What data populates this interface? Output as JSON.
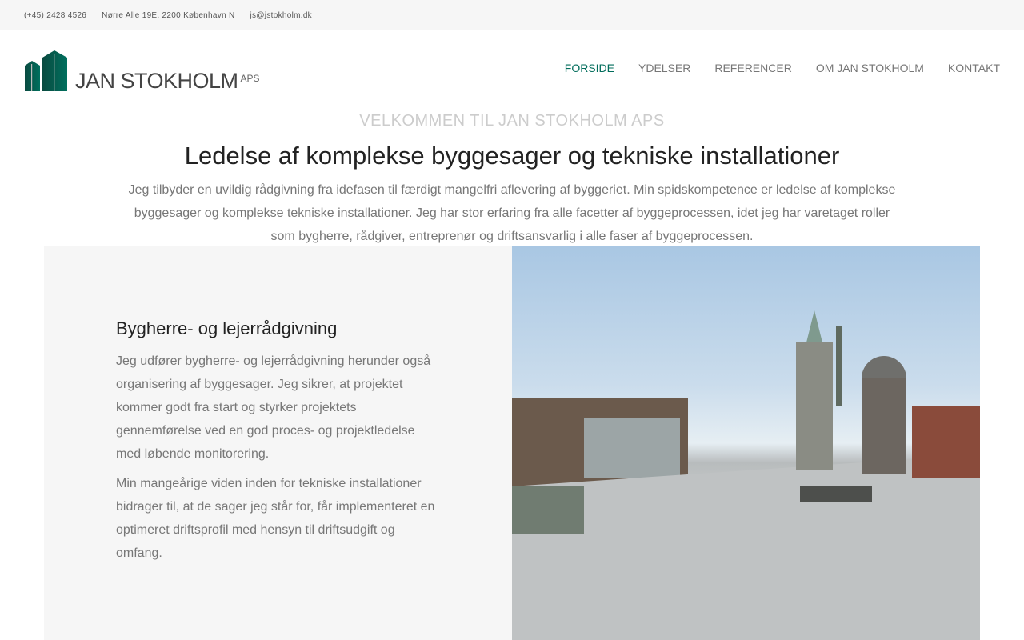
{
  "topbar": {
    "phone": "(+45) 2428 4526",
    "address": "Nørre Alle 19E, 2200 København N",
    "email": "js@jstokholm.dk"
  },
  "logo": {
    "name": "JAN STOKHOLM",
    "suffix": "APS"
  },
  "nav": [
    {
      "label": "FORSIDE"
    },
    {
      "label": "YDELSER"
    },
    {
      "label": "REFERENCER"
    },
    {
      "label": "OM JAN STOKHOLM"
    },
    {
      "label": "KONTAKT"
    }
  ],
  "intro": {
    "kicker": "VELKOMMEN TIL JAN STOKHOLM APS",
    "title": "Ledelse af komplekse byggesager og tekniske installationer",
    "text": "Jeg tilbyder en uvildig rådgivning fra idefasen til færdigt mangelfri aflevering af byggeriet. Min spidskompetence er ledelse af komplekse byggesager og komplekse tekniske installationer. Jeg har stor erfaring fra alle facetter af byggeprocessen, idet jeg har varetaget roller som bygherre, rådgiver, entreprenør og driftsansvarlig i alle faser af byggeprocessen."
  },
  "service": {
    "heading": "Bygherre- og lejerrådgivning",
    "p1": "Jeg udfører bygherre- og lejerrådgivning herunder også organisering af byggesager. Jeg sikrer, at projektet kommer godt fra start og styrker projektets gennemførelse ved en god proces- og projektledelse med løbende monitorering.",
    "p2": "Min mangeårige viden inden for tekniske installationer bidrager til, at de sager jeg står for, får implementeret en optimeret driftsprofil med hensyn til driftsudgift og omfang."
  },
  "colors": {
    "accent": "#006c5b"
  }
}
